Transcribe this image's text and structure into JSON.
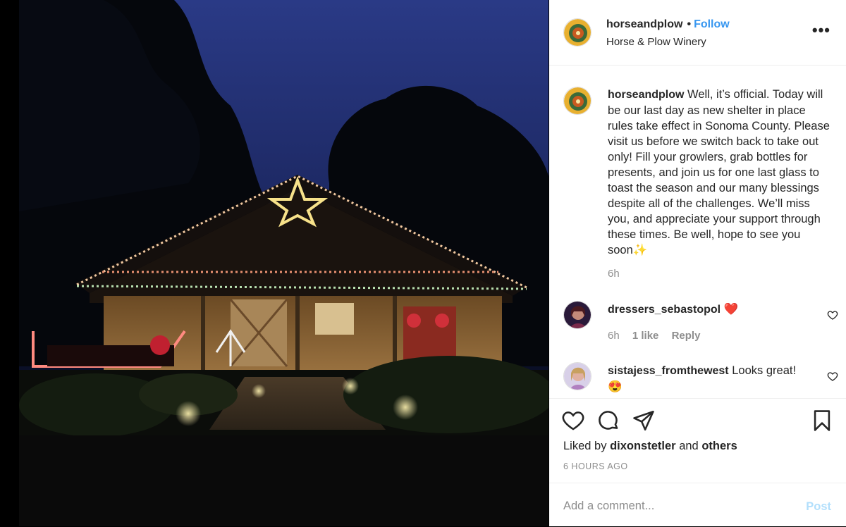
{
  "photo": {
    "alt_icon": "winery-night-photo"
  },
  "header": {
    "username": "horseandplow",
    "separator": "•",
    "follow_label": "Follow",
    "location": "Horse & Plow Winery",
    "more_icon": "more-horizontal-icon",
    "more_label": "•••"
  },
  "caption": {
    "username": "horseandplow",
    "text": "Well, it’s official. Today will be our last day as new shelter in place rules take effect in Sonoma County. Please visit us before we switch back to take out only! Fill your growlers, grab bottles for presents, and join us for one last glass to toast the season and our many blessings despite all of the challenges. We’ll miss you, and appreciate your support through these times. Be well, hope to see you soon✨",
    "time": "6h"
  },
  "comments": [
    {
      "username": "dressers_sebastopol",
      "text": "❤️",
      "time": "6h",
      "likes": "1 like",
      "reply": "Reply"
    },
    {
      "username": "sistajess_fromthewest",
      "text": "Looks great! 😍"
    }
  ],
  "actions": {
    "liked_prefix": "Liked by",
    "liked_user": "dixonstetler",
    "liked_and": "and",
    "liked_others": "others",
    "timestamp": "6 HOURS AGO"
  },
  "add_comment": {
    "placeholder": "Add a comment...",
    "post_label": "Post"
  },
  "colors": {
    "link": "#3897f0",
    "post_disabled": "#b2dffc",
    "muted": "#8e8e8e",
    "text": "#262626"
  }
}
